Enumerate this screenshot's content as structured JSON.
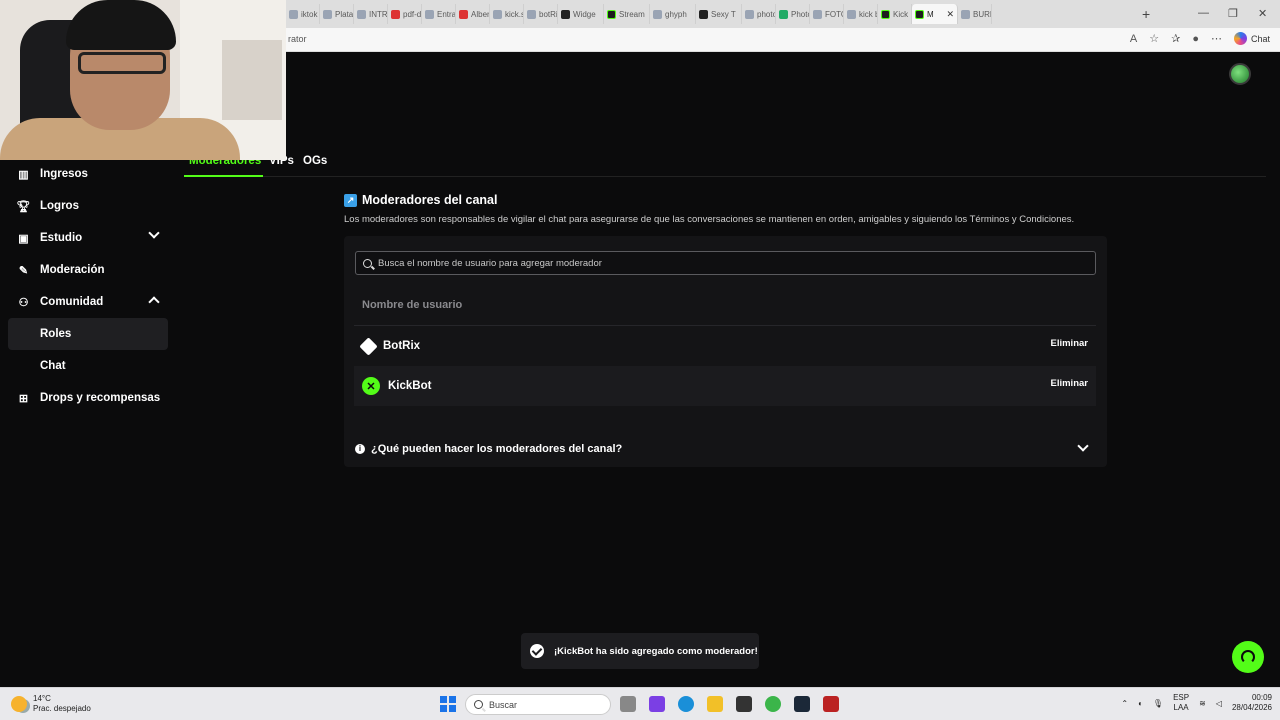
{
  "browser": {
    "tabs": [
      {
        "label": "iktok",
        "icon": "tiktok-icon"
      },
      {
        "label": "Platah",
        "icon": "page-icon"
      },
      {
        "label": "INTRA",
        "icon": "page-icon"
      },
      {
        "label": "pdf-d",
        "icon": "pdf-icon"
      },
      {
        "label": "Entrar",
        "icon": "page-icon"
      },
      {
        "label": "Alber",
        "icon": "youtube-icon"
      },
      {
        "label": "kick.s",
        "icon": "search-icon"
      },
      {
        "label": "botRi",
        "icon": "search-icon"
      },
      {
        "label": "Widge",
        "icon": "github-icon"
      },
      {
        "label": "Stream",
        "icon": "kick-icon"
      },
      {
        "label": "ghyph",
        "icon": "search-icon"
      },
      {
        "label": "Sexy T",
        "icon": "page-icon"
      },
      {
        "label": "photo",
        "icon": "search-icon"
      },
      {
        "label": "Photo",
        "icon": "page-icon"
      },
      {
        "label": "FOTO",
        "icon": "search-icon"
      },
      {
        "label": "kick b",
        "icon": "search-icon"
      },
      {
        "label": "Kick",
        "icon": "kick-icon"
      },
      {
        "label": "M",
        "icon": "kick-icon",
        "active": true
      },
      {
        "label": "BURRO",
        "icon": "search-icon"
      }
    ],
    "address": "rator",
    "chat_label": "Chat"
  },
  "sidebar": {
    "items": [
      {
        "label": "Ingresos",
        "icon": "chart-icon"
      },
      {
        "label": "Logros",
        "icon": "trophy-icon"
      },
      {
        "label": "Estudio",
        "icon": "studio-icon",
        "chevron": "down"
      },
      {
        "label": "Moderación",
        "icon": "wrench-icon"
      },
      {
        "label": "Comunidad",
        "icon": "community-icon",
        "chevron": "up"
      },
      {
        "label": "Roles",
        "sub": true,
        "selected": true
      },
      {
        "label": "Chat",
        "sub": true
      },
      {
        "label": "Drops y recompensas",
        "icon": "gift-icon"
      }
    ]
  },
  "subtabs": [
    {
      "label": "Moderadores",
      "active": true
    },
    {
      "label": "VIPs"
    },
    {
      "label": "OGs"
    }
  ],
  "section": {
    "title": "Moderadores del canal",
    "description": "Los moderadores son responsables de vigilar el chat para asegurarse de que las conversaciones se mantienen en orden, amigables y siguiendo los Términos y Condiciones.",
    "search_placeholder": "Busca el nombre de usuario para agregar moderador",
    "column_header": "Nombre de usuario",
    "moderators": [
      {
        "name": "BotRix",
        "action": "Eliminar"
      },
      {
        "name": "KickBot",
        "action": "Eliminar"
      }
    ],
    "faq": "¿Qué pueden hacer los moderadores del canal?"
  },
  "toast": "¡KickBot ha sido agregado como moderador!",
  "taskbar": {
    "weather_temp": "14°C",
    "weather_desc": "Prac. despejado",
    "search_placeholder": "Buscar",
    "lang_1": "ESP",
    "lang_2": "LAA",
    "time": "00:09",
    "date": "28/04/2026"
  },
  "colors": {
    "accent": "#53fc18",
    "background": "#0b0b0c",
    "panel": "#141416"
  }
}
